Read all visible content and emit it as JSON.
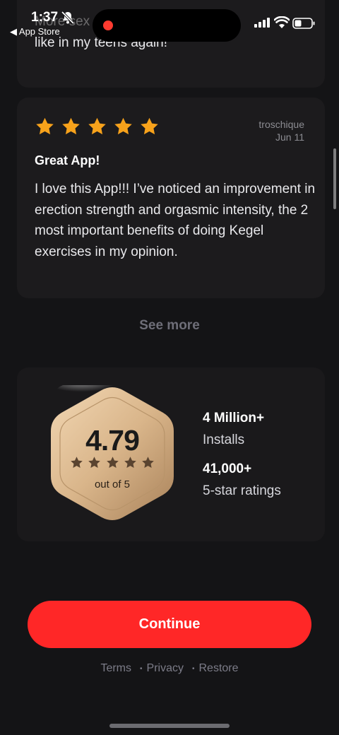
{
  "status_bar": {
    "time": "1:37",
    "back_app": "◀ App Store"
  },
  "previous_review": {
    "line1": "More sex and I last longer",
    "line2": "like in my teens again!"
  },
  "review": {
    "stars": 5,
    "author": "troschique",
    "date": "Jun 11",
    "title": "Great App!",
    "body": "I love this App!!! I’ve noticed an improvement in erection strength and orgasmic intensity, the 2 most important benefits of doing Kegel exercises in my opinion."
  },
  "see_more_label": "See more",
  "rating_badge": {
    "rating": "4.79",
    "subtitle": "out of 5",
    "stars": 5
  },
  "stats": [
    {
      "value": "4 Million+",
      "label": "Installs"
    },
    {
      "value": "41,000+",
      "label": "5-star ratings"
    }
  ],
  "continue_label": "Continue",
  "footer": {
    "terms": "Terms",
    "privacy": "Privacy",
    "restore": "Restore",
    "separator": "•"
  },
  "colors": {
    "background": "#141416",
    "card": "#1c1b1d",
    "star": "#f7a21b",
    "accent": "#ff2727",
    "muted": "#6e6e78"
  }
}
